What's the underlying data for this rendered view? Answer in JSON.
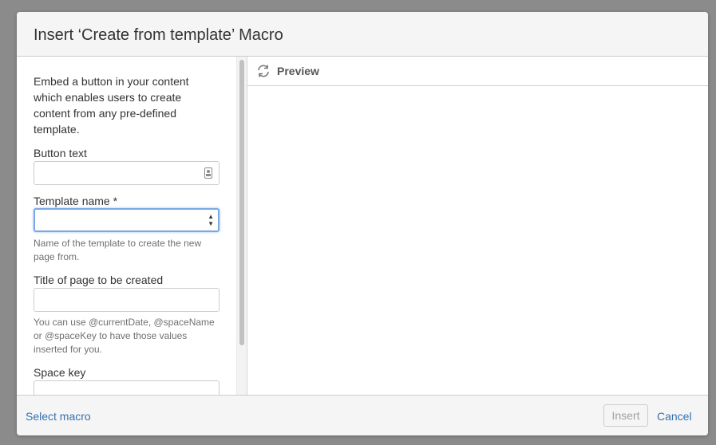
{
  "dialog": {
    "title": "Insert ‘Create from template’ Macro"
  },
  "form": {
    "intro": "Embed a button in your content which enables users to create content from any pre-defined template.",
    "button_text": {
      "label": "Button text",
      "value": ""
    },
    "template_name": {
      "label": "Template name *",
      "value": "",
      "description": "Name of the template to create the new page from."
    },
    "page_title": {
      "label": "Title of page to be created",
      "value": "",
      "description": "You can use @currentDate, @spaceName or @spaceKey to have those values inserted for you."
    },
    "space_key": {
      "label": "Space key",
      "value": ""
    }
  },
  "preview": {
    "label": "Preview",
    "icon": "refresh-icon"
  },
  "footer": {
    "select_macro": "Select macro",
    "insert": "Insert",
    "cancel": "Cancel"
  },
  "colors": {
    "link": "#3572b0",
    "focus": "#7aa7e6",
    "header_bg": "#f5f5f5"
  }
}
